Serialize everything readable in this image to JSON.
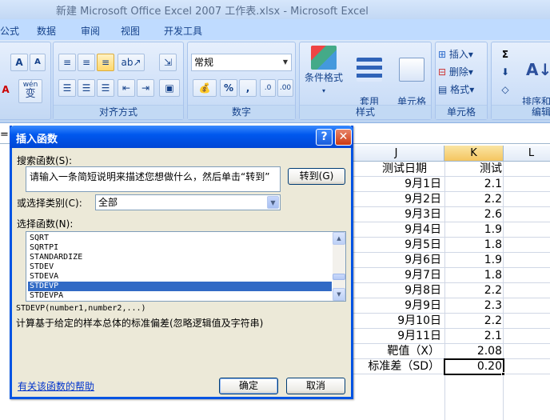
{
  "window": {
    "title": "新建 Microsoft Office Excel 2007 工作表.xlsx - Microsoft Excel"
  },
  "ribbon_tabs": [
    "公式",
    "数据",
    "审阅",
    "视图",
    "开发工具"
  ],
  "ribbon": {
    "groups": {
      "alignment": "对齐方式",
      "number": "数字",
      "styles": "样式",
      "cells": "单元格",
      "editing": "编辑"
    },
    "number_format": "常规",
    "percent": "%",
    "comma": ",",
    "conditional_format": "条件格式",
    "table_format": "套用\n表格格式",
    "cell_style": "单元格\n样式",
    "insert": "插入",
    "delete": "删除",
    "format": "格式",
    "sort_filter": "排序和\n筛选",
    "font_grow": "A",
    "font_shrink": "A",
    "sigma": "Σ",
    "wen": "wén",
    "wen_char": "变",
    "font_color": "A"
  },
  "formula_bar": {
    "left_char": "="
  },
  "dialog": {
    "title": "插入函数",
    "search_label": "搜索函数(S):",
    "search_value": "请输入一条简短说明来描述您想做什么，然后单击“转到”",
    "go_button": "转到(G)",
    "category_label": "或选择类别(C):",
    "category_value": "全部",
    "select_label": "选择函数(N):",
    "functions": [
      "SQRT",
      "SQRTPI",
      "STANDARDIZE",
      "STDEV",
      "STDEVA",
      "STDEVP",
      "STDEVPA"
    ],
    "selected_function": "STDEVP",
    "syntax": "STDEVP(number1,number2,...)",
    "description": "计算基于给定的样本总体的标准偏差(忽略逻辑值及字符串)",
    "help_link": "有关该函数的帮助",
    "ok_button": "确定",
    "cancel_button": "取消"
  },
  "sheet": {
    "columns": [
      "J",
      "K",
      "L"
    ],
    "selected_column": "K",
    "rows": [
      {
        "j": "测试日期",
        "k": "测试"
      },
      {
        "j": "9月1日",
        "k": "2.1"
      },
      {
        "j": "9月2日",
        "k": "2.2"
      },
      {
        "j": "9月3日",
        "k": "2.6"
      },
      {
        "j": "9月4日",
        "k": "1.9"
      },
      {
        "j": "9月5日",
        "k": "1.8"
      },
      {
        "j": "9月6日",
        "k": "1.9"
      },
      {
        "j": "9月7日",
        "k": "1.8"
      },
      {
        "j": "9月8日",
        "k": "2.2"
      },
      {
        "j": "9月9日",
        "k": "2.3"
      },
      {
        "j": "9月10日",
        "k": "2.2"
      },
      {
        "j": "9月11日",
        "k": "2.1"
      },
      {
        "j": "靶值（X）",
        "k": "2.08"
      },
      {
        "j": "标准差（SD）",
        "k": "0.20"
      }
    ]
  },
  "colors": {
    "ribbon": "#bfdbff",
    "dialog_title": "#0058ee",
    "selection": "#316ac5"
  }
}
